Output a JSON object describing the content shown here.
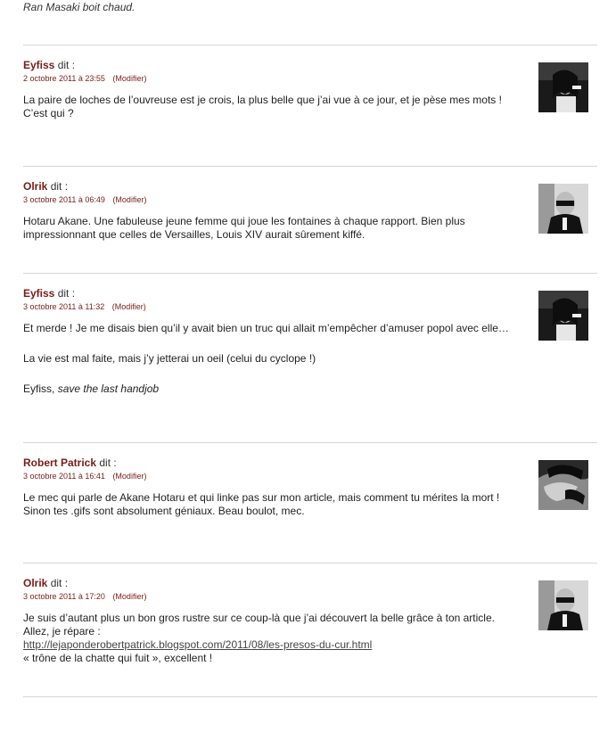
{
  "intro": {
    "text": "Ran Masaki boit chaud."
  },
  "dit_label": "dit :",
  "modify_label": "(Modifier)",
  "comments": [
    {
      "author": "Eyfiss",
      "date": "2 octobre 2011 à 23:55",
      "avatar": "eyfiss-avatar",
      "lines": [
        "La paire de loches de l’ouvreuse est je crois, la plus belle que j’ai vue à ce jour, et je pèse mes mots !",
        "C’est qui ?"
      ]
    },
    {
      "author": "Olrik",
      "date": "3 octobre 2011 à 06:49",
      "avatar": "olrik-avatar",
      "lines": [
        "Hotaru Akane. Une fabuleuse jeune femme qui joue les fontaines à chaque rapport. Bien plus impressionnant que celles de Versailles, Louis XIV aurait sûrement kiffé."
      ]
    },
    {
      "author": "Eyfiss",
      "date": "3 octobre 2011 à 11:32",
      "avatar": "eyfiss-avatar",
      "lines": [
        "Et merde ! Je me disais bien qu’il y avait bien un truc qui allait m’empêcher d’amuser popol avec elle…",
        "La vie est mal faite, mais j’y jetterai un oeil (celui du cyclope !)",
        "Eyfiss,",
        "save the last handjob"
      ]
    },
    {
      "author": "Robert Patrick",
      "date": "3 octobre 2011 à 16:41",
      "avatar": "robert-patrick-avatar",
      "lines": [
        "Le mec qui parle de Akane Hotaru et qui linke pas sur mon article, mais comment tu mérites la mort !",
        "Sinon tes .gifs sont absolument géniaux. Beau boulot, mec."
      ]
    },
    {
      "author": "Olrik",
      "date": "3 octobre 2011 à 17:20",
      "avatar": "olrik-avatar",
      "lines": [
        "Je suis d’autant plus un bon gros rustre sur ce coup-là que j’ai découvert la belle grâce à ton article. Allez, je répare :",
        "http://lejaponderobertpatrick.blogspot.com/2011/08/les-presos-du-cur.html",
        "« trône de la chatte qui fuit », excellent !"
      ]
    }
  ]
}
